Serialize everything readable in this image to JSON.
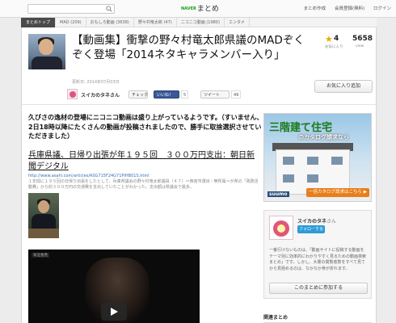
{
  "topbar": {
    "logo_prefix": "NAVER",
    "logo_text": "まとめ",
    "links": [
      "まとめ作成",
      "会員登録(無料)",
      "ログイン"
    ]
  },
  "catnav": {
    "items": [
      "まとめトップ",
      "MAD (209)",
      "おもしろ動画 (3638)",
      "野々村竜太郎 (47)",
      "ニコニコ動画 (1980)",
      "エンタメ"
    ]
  },
  "article": {
    "title": "【動画集】衝撃の野々村竜太郎県議のMADぞくぞく登場「2014ネタキャラメンバー入り」",
    "updated": "更新日: 2014年07月03日",
    "author": "スイカのタネさん",
    "share": {
      "mixi_label": "チェック",
      "mixi_count": "0",
      "fb_label": "いいね！",
      "fb_count": "5",
      "tw_label": "ツイート",
      "tw_count": "49"
    },
    "favorites": "4",
    "favorites_label": "お気に入り",
    "views": "5658",
    "views_label": "view",
    "fav_button": "お気に入り追加",
    "lead": "久びさの逸材の登場にニコニコ動画は盛り上がっているようです。（すいません、2日18時以降にたくさんの動画が投稿されましたので、勝手に取捨選択させていただきました）",
    "link_title": "兵庫県議、日帰り出張が年１９５回　３００万円支出：朝日新聞デジタル",
    "link_url": "http://www.asahi.com/articles/ASG715F24G71PIHB01S.html",
    "link_desc": "１年間に１９５回の日帰り出張をしたとして、兵庫県議会の野々村竜太郎議員（４７）＝西宮市選出・無所属＝が県の「政務活動費」から約３００万円の交通費を支出していたことがわかった。支出額は県議会で最多。",
    "video_label": "号泣会見"
  },
  "ad": {
    "headline": "三階建て住宅",
    "sub": "のカタログ請求なら",
    "button": "一括カタログ請求はこちら ▶",
    "brand": "suumo"
  },
  "profile": {
    "name": "スイカのタネ",
    "name_suffix": "さん",
    "follow": "フォローする",
    "bio": "一番行けないものは、「動画サイトに投稿する動画をテーマ別に効率的にわかりやすく見るための動画検索まとめ」です。しかし、大量の閲覧者数をすべて見てから見極めるのは、なかなか骨が折れます。",
    "join": "このまとめに参加する"
  },
  "related_title": "関連まとめ",
  "colors": {
    "accent_green": "#1aa01a",
    "star": "#f0a800",
    "facebook": "#3b5998",
    "ad_button": "#e87e1a"
  }
}
